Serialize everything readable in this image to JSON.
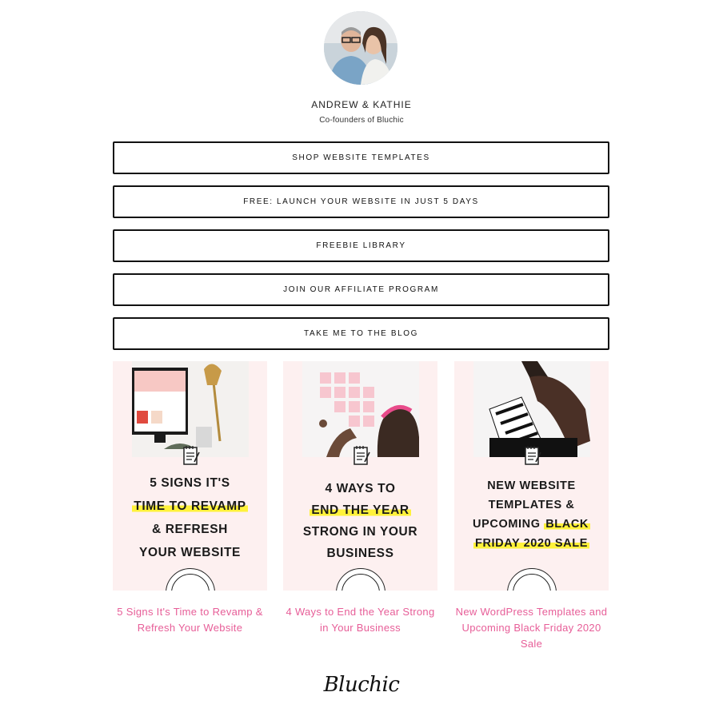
{
  "profile": {
    "name": "ANDREW & KATHIE",
    "subtitle": "Co-founders of Bluchic"
  },
  "links": [
    {
      "label": "SHOP WEBSITE TEMPLATES"
    },
    {
      "label": "FREE: LAUNCH YOUR WEBSITE IN JUST 5 DAYS"
    },
    {
      "label": "FREEBIE LIBRARY"
    },
    {
      "label": "JOIN OUR AFFILIATE PROGRAM"
    },
    {
      "label": "TAKE ME TO THE BLOG"
    }
  ],
  "posts": [
    {
      "headline_lines": [
        "5 SIGNS IT'S",
        "TIME TO REVAMP",
        "& REFRESH",
        "YOUR WEBSITE"
      ],
      "caption": "5 Signs It's Time to Revamp & Refresh Your Website"
    },
    {
      "headline_lines": [
        "4 WAYS TO",
        "END THE YEAR",
        "STRONG IN YOUR",
        "BUSINESS"
      ],
      "caption": "4 Ways to End the Year Strong in Your Business"
    },
    {
      "headline_lines": [
        "NEW WEBSITE",
        "TEMPLATES &",
        "UPCOMING ",
        "BLACK",
        "FRIDAY 2020 SALE"
      ],
      "caption": "New WordPress Templates and Upcoming Black Friday 2020 Sale"
    }
  ],
  "footer": {
    "logo_text": "Bluchic"
  },
  "colors": {
    "accent_pink": "#e75e98",
    "card_bg": "#fdf0f0",
    "highlight_yellow": "#fff23a"
  },
  "icons": [
    "avatar-photo",
    "notepad-icon",
    "bluchic-seal-logo"
  ]
}
